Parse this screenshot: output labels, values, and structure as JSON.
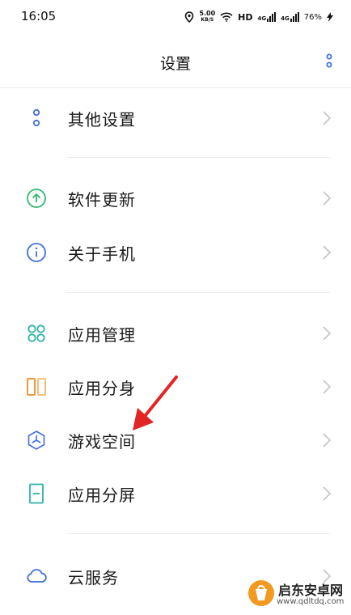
{
  "status_bar": {
    "time": "16:05",
    "speed_value": "5.00",
    "speed_unit": "KB/S",
    "hd": "HD",
    "net1": "4G",
    "net2": "4G",
    "battery": "76%",
    "icons": [
      "location-icon",
      "wifi-icon",
      "signal-icon",
      "charging-icon"
    ]
  },
  "header": {
    "title": "设置",
    "more_icon": "more-vertical-icon"
  },
  "items": [
    {
      "label": "其他设置",
      "icon": "more-settings-icon"
    },
    {
      "label": "软件更新",
      "icon": "update-icon"
    },
    {
      "label": "关于手机",
      "icon": "info-icon"
    },
    {
      "label": "应用管理",
      "icon": "app-grid-icon"
    },
    {
      "label": "应用分身",
      "icon": "app-clone-icon"
    },
    {
      "label": "游戏空间",
      "icon": "game-space-icon"
    },
    {
      "label": "应用分屏",
      "icon": "split-screen-icon"
    },
    {
      "label": "云服务",
      "icon": "cloud-icon"
    }
  ],
  "watermark": {
    "name": "启东安卓网",
    "url": "www.qdltdq.com"
  },
  "colors": {
    "accent_blue": "#3f6ed8",
    "green": "#33b86b",
    "teal": "#2bb3a8",
    "orange": "#f08a24",
    "annotation_red": "#e32424"
  }
}
